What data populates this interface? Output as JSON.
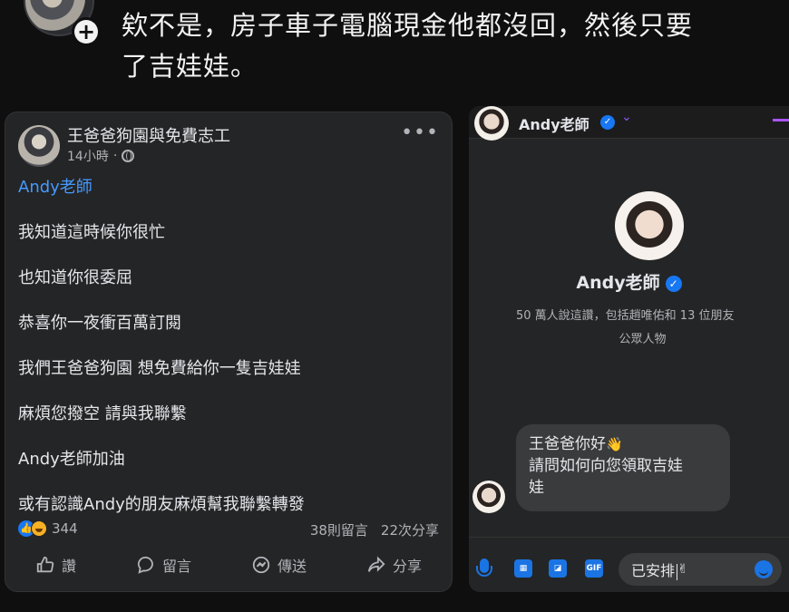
{
  "caption": {
    "line1": "欸不是，房子車子電腦現金他都沒回，然後只要",
    "line2": "了吉娃娃。"
  },
  "post": {
    "page_name": "王爸爸狗園與免費志工",
    "time": "14小時",
    "dot": "·",
    "mention": "Andy老師",
    "lines": [
      "我知道這時候你很忙",
      "也知道你很委屈",
      "恭喜你一夜衝百萬訂閱",
      "我們王爸爸狗園 想免費給你一隻吉娃娃",
      "麻煩您撥空 請與我聯繫",
      "Andy老師加油",
      "或有認識Andy的朋友麻煩幫我聯繫轉發"
    ],
    "reaction_count": "344",
    "comments": "38則留言",
    "shares": "22次分享",
    "actions": {
      "like": "讚",
      "comment": "留言",
      "send": "傳送",
      "share": "分享"
    }
  },
  "messenger": {
    "header_name": "Andy老師",
    "profile_name": "Andy老師",
    "likes_text": "50 萬人說這讚，包括趙唯佑和 13 位朋友",
    "category": "公眾人物",
    "message_line1": "王爸爸你好",
    "message_line2": "請問如何向您領取吉娃",
    "message_line3": "娃",
    "input_value": "已安排",
    "gif_label": "GIF",
    "colors": {
      "accent": "#1b74e4",
      "bubble": "#3a3b3c"
    },
    "icons": [
      "mic-icon",
      "photo-icon",
      "sticker-icon",
      "gif-icon",
      "emoji-icon"
    ]
  }
}
